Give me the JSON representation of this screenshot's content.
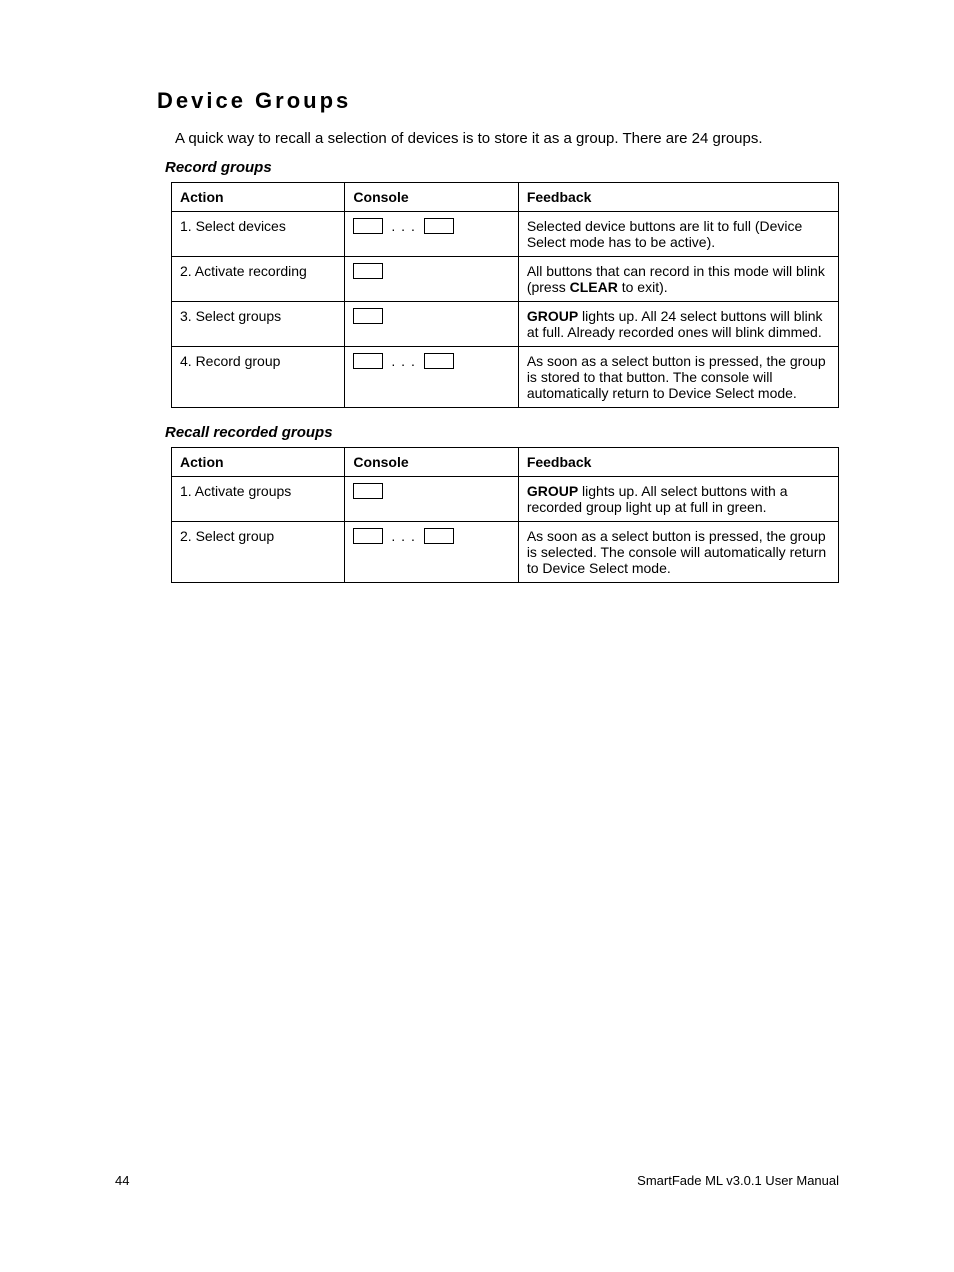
{
  "heading": "Device Groups",
  "intro": "A quick way to recall a selection of devices is to store it as a group. There are 24 groups.",
  "section1": {
    "title": "Record groups",
    "headers": {
      "action": "Action",
      "console": "Console",
      "feedback": "Feedback"
    },
    "rows": [
      {
        "action": "1. Select devices",
        "console_type": "multi",
        "feedback_html": "Selected device buttons are lit to full (Device Select mode has to be active)."
      },
      {
        "action": "2. Activate recording",
        "console_type": "single",
        "feedback_html": "All buttons that can record in this mode will blink (press <b>CLEAR</b> to exit)."
      },
      {
        "action": "3. Select groups",
        "console_type": "single",
        "feedback_html": "<b>GROUP</b> lights up. All 24 select buttons will blink at full. Already recorded ones will blink dimmed."
      },
      {
        "action": "4. Record group",
        "console_type": "multi",
        "feedback_html": "As soon as a select button is pressed, the group is stored to that button. The console will automatically return to Device Select mode."
      }
    ]
  },
  "section2": {
    "title": "Recall recorded groups",
    "headers": {
      "action": "Action",
      "console": "Console",
      "feedback": "Feedback"
    },
    "rows": [
      {
        "action": "1. Activate groups",
        "console_type": "single",
        "feedback_html": "<b>GROUP</b> lights up. All select buttons with a recorded group light up at full in green."
      },
      {
        "action": "2. Select group",
        "console_type": "multi",
        "feedback_html": "As soon as a select button is pressed, the group is selected. The console will automatically return to Device Select mode."
      }
    ]
  },
  "footer": {
    "page": "44",
    "doc": "SmartFade ML v3.0.1 User Manual"
  }
}
